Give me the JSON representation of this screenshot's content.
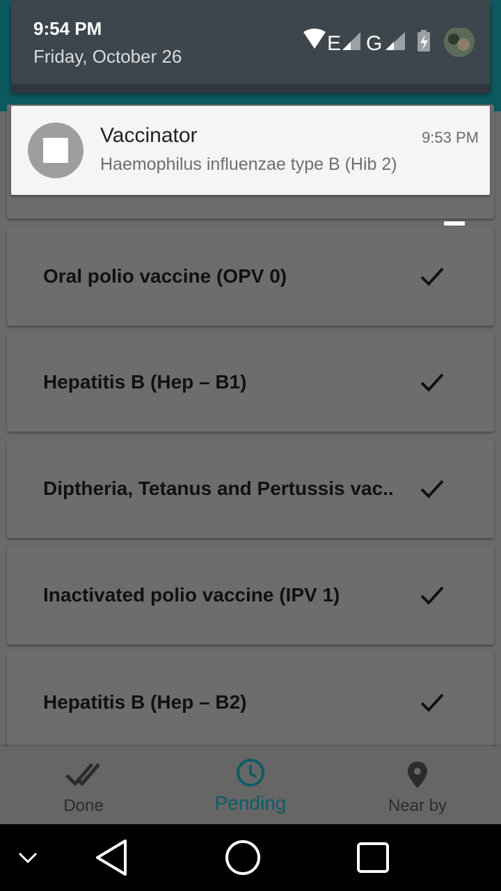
{
  "status": {
    "time": "9:54 PM",
    "date": "Friday, October 26",
    "network_1": "E",
    "network_2": "G"
  },
  "notification": {
    "app_name": "Vaccinator",
    "time": "9:53 PM",
    "text": "Haemophilus influenzae type B (Hib 2)"
  },
  "vaccines": [
    {
      "name": "Oral polio vaccine (OPV 0)"
    },
    {
      "name": "Hepatitis B (Hep – B1)"
    },
    {
      "name": "Diptheria, Tetanus and Pertussis vac.."
    },
    {
      "name": "Inactivated polio vaccine (IPV 1)"
    },
    {
      "name": "Hepatitis B  (Hep – B2)"
    }
  ],
  "bottom_nav": {
    "done_label": "Done",
    "pending_label": "Pending",
    "near_label": "Near by",
    "active_color": "#0d5d66"
  },
  "icons": {
    "sort": "sort-lines-icon",
    "check": "checkmark-icon",
    "done": "double-check-icon",
    "pending": "clock-icon",
    "near": "location-pin-icon"
  }
}
